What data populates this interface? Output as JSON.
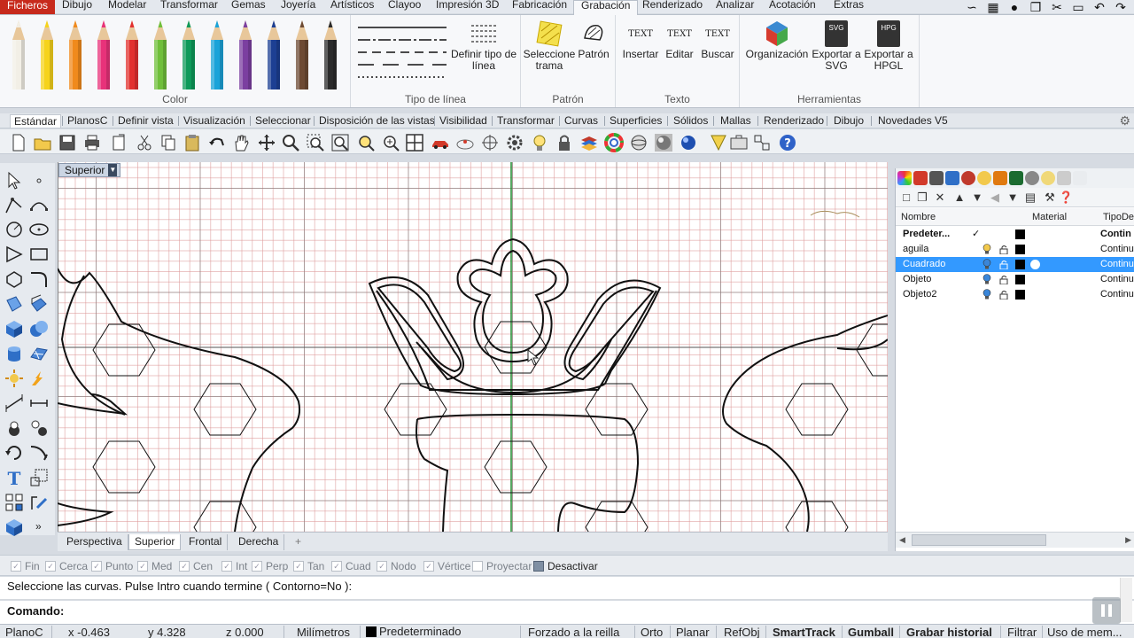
{
  "ribbon": {
    "tabs": [
      "Ficheros",
      "Dibujo",
      "Modelar",
      "Transformar",
      "Gemas",
      "Joyería",
      "Artísticos",
      "Clayoo",
      "Impresión 3D",
      "Fabricación",
      "Grabación",
      "Renderizado",
      "Analizar",
      "Acotación",
      "Extras"
    ],
    "active_tab": "Grabación",
    "groups": {
      "color": "Color",
      "linetype": "Tipo de línea",
      "pattern": "Patrón",
      "text": "Texto",
      "tools": "Herramientas"
    },
    "buttons": {
      "define_linetype": "Definir tipo de línea",
      "select_hatch": "Seleccione trama",
      "pattern": "Patrón",
      "insert": "Insertar",
      "edit": "Editar",
      "search": "Buscar",
      "organization": "Organización",
      "export_svg": "Exportar a SVG",
      "export_hpgl": "Exportar a HPGL"
    },
    "text_icon_labels": [
      "TEXT",
      "TEXT",
      "TEXT"
    ],
    "svg_icon_text": "SVG",
    "hpg_icon_text": "HPG",
    "pencil_colors": [
      "#f2efe6",
      "#f6d31b",
      "#f08a1c",
      "#e8327a",
      "#e2302e",
      "#6fbf3a",
      "#0e9a5a",
      "#1aa3d9",
      "#7b3fa0",
      "#1d3f93",
      "#6d4a33",
      "#2b2b2b"
    ]
  },
  "toolbar_tabs": [
    "Estándar",
    "PlanosC",
    "Definir vista",
    "Visualización",
    "Seleccionar",
    "Disposición de las vistas",
    "Visibilidad",
    "Transformar",
    "Curvas",
    "Superficies",
    "Sólidos",
    "Mallas",
    "Renderizado",
    "Dibujo",
    "Novedades V5"
  ],
  "viewport": {
    "label": "Superior",
    "tabs": [
      "Perspectiva",
      "Superior",
      "Frontal",
      "Derecha"
    ],
    "active_tab": "Superior",
    "add_tab_symbol": "+"
  },
  "layers": {
    "columns": {
      "name": "Nombre",
      "material": "Material",
      "linetype": "TipoDe"
    },
    "rows": [
      {
        "name": "Predeter...",
        "current": "✓",
        "linetype": "Contin",
        "selected": false,
        "bold": true
      },
      {
        "name": "aguila",
        "linetype": "Continua",
        "selected": false,
        "bold": false
      },
      {
        "name": "Cuadrado",
        "linetype": "Continua",
        "selected": true,
        "bold": false
      },
      {
        "name": "Objeto",
        "linetype": "Continua",
        "selected": false,
        "bold": false
      },
      {
        "name": "Objeto2",
        "linetype": "Continua",
        "selected": false,
        "bold": false
      }
    ]
  },
  "osnaps": [
    "Fin",
    "Cerca",
    "Punto",
    "Med",
    "Cen",
    "Int",
    "Perp",
    "Tan",
    "Cuad",
    "Nodo",
    "Vértice",
    "Proyectar",
    "Desactivar"
  ],
  "command": {
    "history": "Seleccione las curvas. Pulse Intro cuando termine ( Contorno=No ):",
    "prompt": "Comando:"
  },
  "status": {
    "cplane": "PlanoC",
    "x": "x -0.463",
    "y": "y 4.328",
    "z": "z 0.000",
    "units": "Milímetros",
    "layer": "Predeterminado",
    "grid_snap": "Forzado a la reilla",
    "ortho": "Orto",
    "planar": "Planar",
    "osnap": "RefObj",
    "smarttrack": "SmartTrack",
    "gumball": "Gumball",
    "history": "Grabar historial",
    "filter": "Filtrar",
    "memory": "Uso de mem..."
  },
  "colors": {
    "file_tab": "#c72a1c",
    "selection": "#3399ff",
    "axis_green": "#1e8a2e"
  }
}
